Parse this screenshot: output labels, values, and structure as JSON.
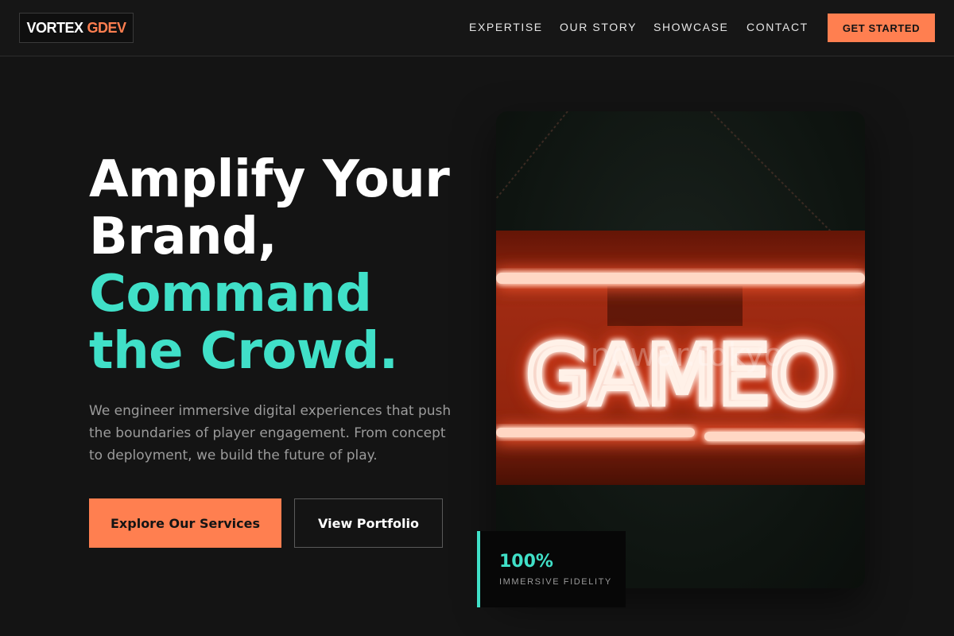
{
  "brand": {
    "part1": "VORTEX",
    "part2": "GDEV",
    "accent_color": "#ff7f50"
  },
  "nav": {
    "links": [
      "EXPERTISE",
      "OUR STORY",
      "SHOWCASE",
      "CONTACT"
    ],
    "cta_label": "GET STARTED"
  },
  "hero": {
    "headline_line1": "Amplify Your",
    "headline_line2": "Brand,",
    "headline_line3": "Command",
    "headline_line4": "the Crowd.",
    "highlight_color": "#40e0c8",
    "description": "We engineer immersive digital experiences that push the boundaries of player engagement. From concept to deployment, we build the future of play.",
    "primary_button": "Explore Our Services",
    "secondary_button": "View Portfolio"
  },
  "showcase_image": {
    "neon_sign_text": "GAMEO",
    "watermark": "nowar.tokyo"
  },
  "stat": {
    "value": "100%",
    "label": "IMMERSIVE FIDELITY"
  }
}
